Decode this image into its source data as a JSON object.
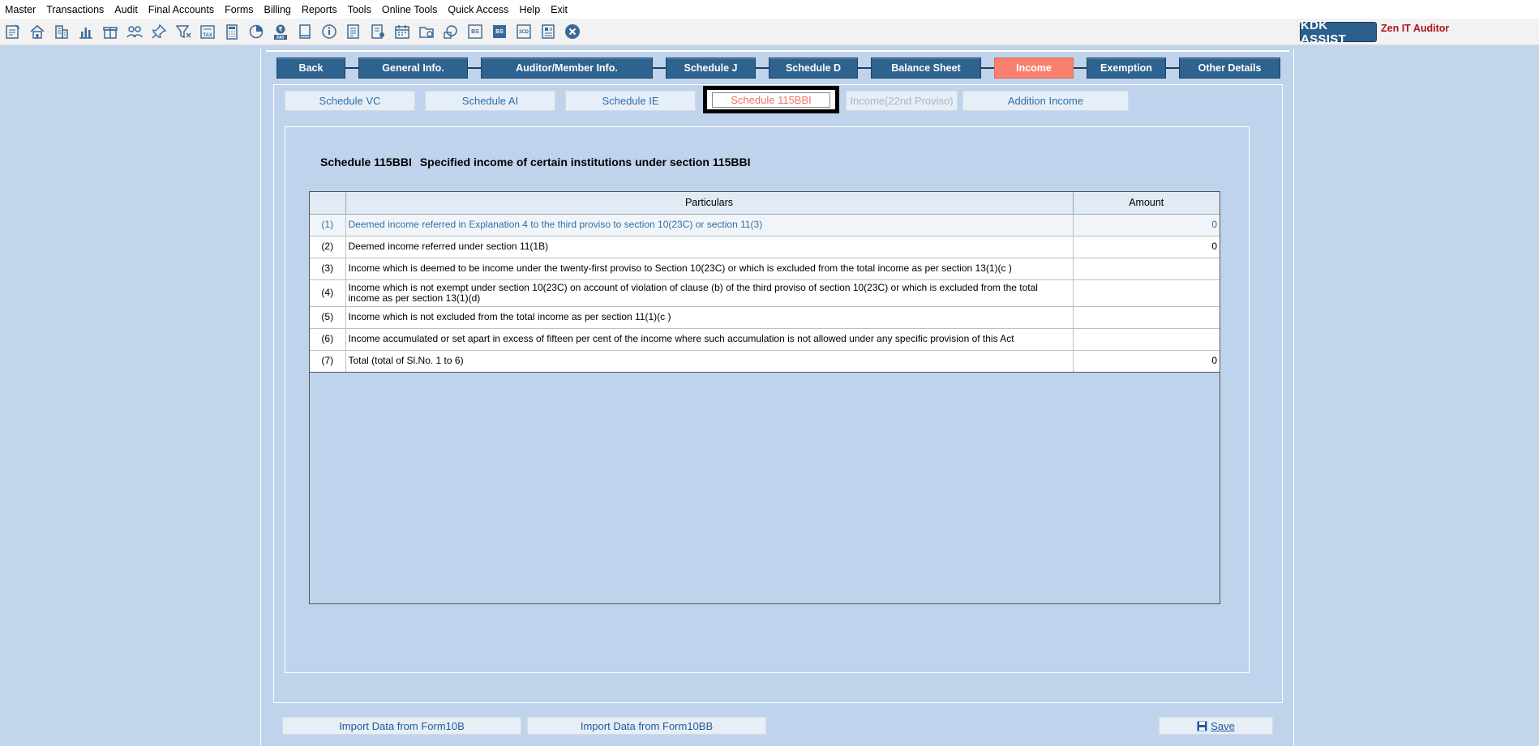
{
  "menu": [
    "Master",
    "Transactions",
    "Audit",
    "Final Accounts",
    "Forms",
    "Billing",
    "Reports",
    "Tools",
    "Online Tools",
    "Quick Access",
    "Help",
    "Exit"
  ],
  "toolbar_icons": [
    "open-icon",
    "home-icon",
    "buildings-icon",
    "bar-chart-icon",
    "gift-icon",
    "users-icon",
    "pin-icon",
    "filter-icon",
    "tax-icon",
    "calculator-icon",
    "pie-icon",
    "pay-icon",
    "book-icon",
    "info-icon",
    "document-icon",
    "user-document-icon",
    "calendar-icon",
    "folder-icon",
    "chat-icon",
    "bs-icon",
    "bs-dark-icon",
    "3cd-icon",
    "report-icon",
    "close-icon"
  ],
  "branding": {
    "assist": "KDK ASSIST",
    "product": "Zen IT Auditor"
  },
  "main_tabs": [
    {
      "label": "Back"
    },
    {
      "label": "General Info."
    },
    {
      "label": "Auditor/Member Info."
    },
    {
      "label": "Schedule J"
    },
    {
      "label": "Schedule D"
    },
    {
      "label": "Balance Sheet"
    },
    {
      "label": "Income",
      "active": true
    },
    {
      "label": "Exemption"
    },
    {
      "label": "Other Details"
    }
  ],
  "sub_tabs": [
    {
      "label": "Schedule VC"
    },
    {
      "label": "Schedule AI"
    },
    {
      "label": "Schedule IE"
    },
    {
      "label": "Schedule 115BBI",
      "selected": true
    },
    {
      "label": "Income(22nd Proviso)",
      "disabled": true
    },
    {
      "label": "Addition Income"
    }
  ],
  "section": {
    "code": "Schedule 115BBI",
    "title": "Specified income of certain institutions under section 115BBI"
  },
  "table": {
    "headers": [
      "",
      "Particulars",
      "Amount"
    ],
    "rows": [
      {
        "sl": "(1)",
        "particular": "Deemed income referred in Explanation 4 to the third proviso to section 10(23C) or  section 11(3)",
        "amount": "0"
      },
      {
        "sl": "(2)",
        "particular": "Deemed income referred under section 11(1B)",
        "amount": "0"
      },
      {
        "sl": "(3)",
        "particular": "Income which is deemed to be income under the twenty-first proviso to Section 10(23C) or which is excluded from the total income as per section 13(1)(c )",
        "amount": ""
      },
      {
        "sl": "(4)",
        "particular": "Income which is not exempt under section 10(23C) on account of violation of clause (b) of the third proviso of section 10(23C) or which is excluded from the total income as per section 13(1)(d)",
        "amount": ""
      },
      {
        "sl": "(5)",
        "particular": "Income which is not excluded from the total income as per section 11(1)(c )",
        "amount": ""
      },
      {
        "sl": "(6)",
        "particular": "Income accumulated or set apart in excess of fifteen per cent of the income where such accumulation is not allowed under any specific provision of this Act",
        "amount": ""
      },
      {
        "sl": "(7)",
        "particular": "Total (total of Sl.No. 1 to 6)",
        "amount": "0"
      }
    ]
  },
  "buttons": {
    "import_10b": "Import Data from Form10B",
    "import_10bb": "Import Data from Form10BB",
    "save": "Save"
  },
  "colors": {
    "background": "#c3d5ea",
    "tab": "#2e628f",
    "tab_active": "#f9806e",
    "link_text": "#2f6fa6",
    "brand_red": "#b0121b"
  }
}
